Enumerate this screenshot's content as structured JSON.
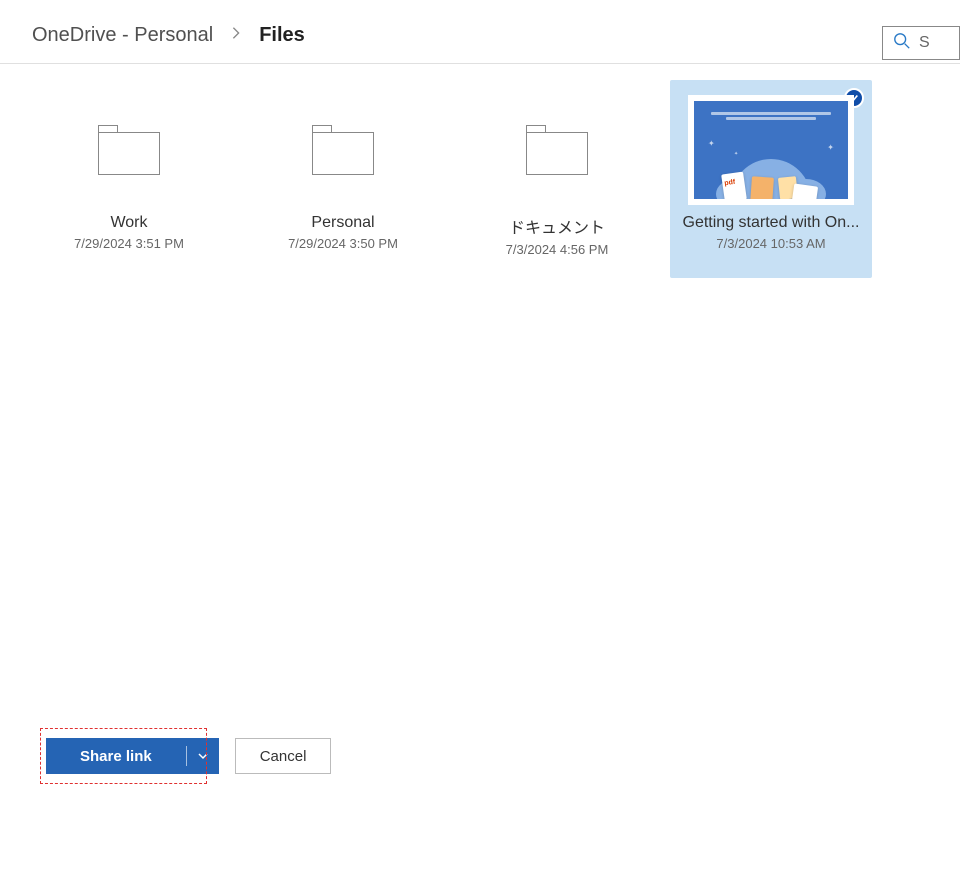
{
  "breadcrumb": {
    "root": "OneDrive - Personal",
    "current": "Files"
  },
  "search": {
    "placeholder": "S"
  },
  "items": [
    {
      "type": "folder",
      "name": "Work",
      "date": "7/29/2024 3:51 PM",
      "selected": false
    },
    {
      "type": "folder",
      "name": "Personal",
      "date": "7/29/2024 3:50 PM",
      "selected": false
    },
    {
      "type": "folder",
      "name": "ドキュメント",
      "date": "7/3/2024 4:56 PM",
      "selected": false
    },
    {
      "type": "file",
      "name": "Getting started with On...",
      "date": "7/3/2024 10:53 AM",
      "selected": true
    }
  ],
  "footer": {
    "share_label": "Share link",
    "cancel_label": "Cancel"
  }
}
